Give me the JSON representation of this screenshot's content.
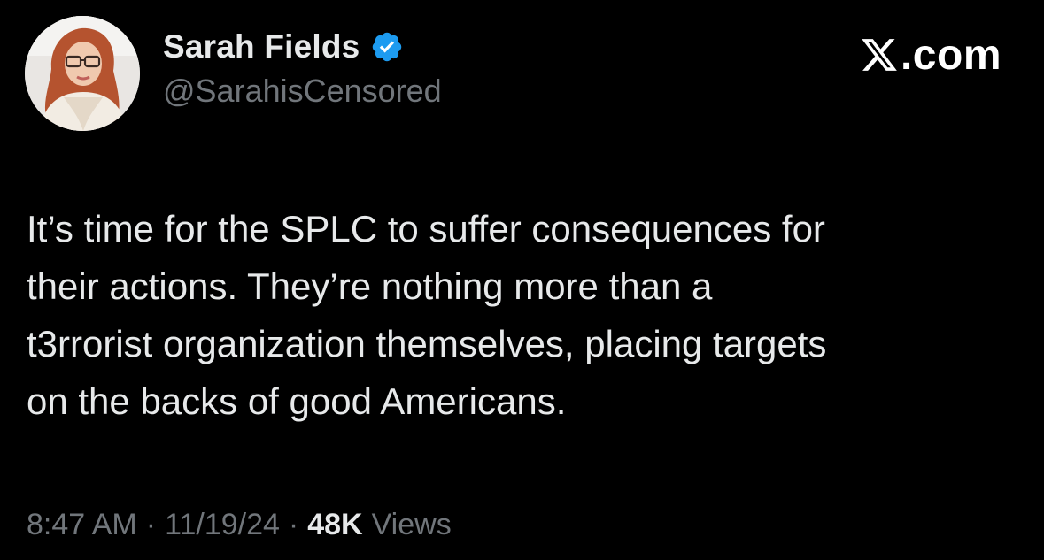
{
  "tweet": {
    "author": {
      "display_name": "Sarah Fields",
      "handle": "@SarahisCensored",
      "verified": true,
      "verified_color": "#1d9bf0"
    },
    "site_mark": {
      "icon": "x-logo-icon",
      "text": ".com"
    },
    "text_lines": [
      "It’s time for the SPLC to suffer consequences for",
      "their actions. They’re nothing more than a",
      "t3rrorist organization themselves, placing targets",
      "on the backs of good Americans."
    ],
    "meta": {
      "time": "8:47 AM",
      "separator": "·",
      "date": "11/19/24",
      "views_count": "48K",
      "views_label": "Views"
    }
  },
  "colors": {
    "background": "#000000",
    "primary_text": "#e7e9ea",
    "secondary_text": "#71767b",
    "accent": "#1d9bf0"
  }
}
